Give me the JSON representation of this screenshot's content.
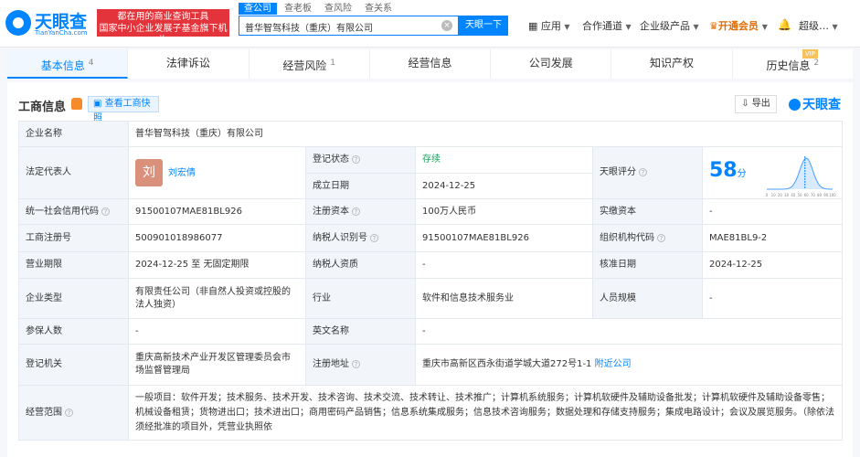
{
  "brand": {
    "logo_text": "天眼查",
    "logo_sub": "TianYanCha.com",
    "slogan_1": "都在用的商业查询工具",
    "slogan_2": "国家中小企业发展子基金旗下机构"
  },
  "search": {
    "tabs": [
      "查公司",
      "查老板",
      "查风险",
      "查关系"
    ],
    "value": "普华智驾科技（重庆）有限公司",
    "button": "天眼一下"
  },
  "nav": {
    "app": "应用",
    "partner": "合作通道",
    "enterprise": "企业级产品",
    "vip": "开通会员",
    "user": "超级…"
  },
  "tabs": [
    {
      "label": "基本信息",
      "count": "4"
    },
    {
      "label": "法律诉讼",
      "count": ""
    },
    {
      "label": "经营风险",
      "count": "1"
    },
    {
      "label": "经营信息",
      "count": ""
    },
    {
      "label": "公司发展",
      "count": ""
    },
    {
      "label": "知识产权",
      "count": ""
    },
    {
      "label": "历史信息",
      "count": "2",
      "badge": "VIP"
    }
  ],
  "section": {
    "title": "工商信息",
    "snapshot": "查看工商快照",
    "export": "导出",
    "brand": "天眼查"
  },
  "info": {
    "company_name_k": "企业名称",
    "company_name_v": "普华智驾科技（重庆）有限公司",
    "legal_rep_k": "法定代表人",
    "legal_rep_avatar": "刘",
    "legal_rep_v": "刘宏倩",
    "status_k": "登记状态",
    "status_v": "存续",
    "founded_k": "成立日期",
    "founded_v": "2024-12-25",
    "score_k": "天眼评分",
    "score_v": "58",
    "score_unit": "分",
    "credit_code_k": "统一社会信用代码",
    "credit_code_v": "91500107MAE81BL926",
    "reg_capital_k": "注册资本",
    "reg_capital_v": "100万人民币",
    "paid_capital_k": "实缴资本",
    "paid_capital_v": "-",
    "reg_no_k": "工商注册号",
    "reg_no_v": "500901018986077",
    "taxpayer_id_k": "纳税人识别号",
    "taxpayer_id_v": "91500107MAE81BL926",
    "org_code_k": "组织机构代码",
    "org_code_v": "MAE81BL9-2",
    "term_k": "营业期限",
    "term_v": "2024-12-25 至 无固定期限",
    "taxpayer_q_k": "纳税人资质",
    "taxpayer_q_v": "-",
    "approve_k": "核准日期",
    "approve_v": "2024-12-25",
    "type_k": "企业类型",
    "type_v": "有限责任公司（非自然人投资或控股的法人独资）",
    "industry_k": "行业",
    "industry_v": "软件和信息技术服务业",
    "staff_k": "人员规模",
    "staff_v": "-",
    "insured_k": "参保人数",
    "insured_v": "-",
    "en_name_k": "英文名称",
    "en_name_v": "-",
    "authority_k": "登记机关",
    "authority_v": "重庆高新技术产业开发区管理委员会市场监督管理局",
    "address_k": "注册地址",
    "address_v": "重庆市高新区西永街道学城大道272号1-1",
    "address_link": "附近公司",
    "scope_k": "经营范围",
    "scope_v": "一般项目：软件开发；技术服务、技术开发、技术咨询、技术交流、技术转让、技术推广；计算机系统服务；计算机软硬件及辅助设备批发；计算机软硬件及辅助设备零售；机械设备租赁；货物进出口；技术进出口；商用密码产品销售；信息系统集成服务；信息技术咨询服务；数据处理和存储支持服务；集成电路设计；会议及展览服务。（除依法须经批准的项目外，凭营业执照依"
  },
  "score_chart": {
    "x_ticks": [
      "0",
      "10",
      "20",
      "30",
      "40",
      "50",
      "60",
      "70",
      "80",
      "90",
      "100"
    ],
    "marker": 58
  }
}
